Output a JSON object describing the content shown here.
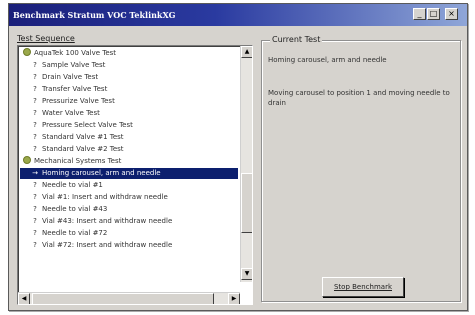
{
  "window": {
    "title": "Benchmark Stratum VOC TeklinkXG",
    "min_glyph": "_",
    "max_glyph": "□",
    "close_glyph": "×"
  },
  "sequence": {
    "label": "Test Sequence",
    "items": [
      {
        "icon": "group",
        "label": "AquaTek 100 Valve Test",
        "selected": false
      },
      {
        "icon": "?",
        "label": "Sample Valve Test",
        "selected": false
      },
      {
        "icon": "?",
        "label": "Drain Valve Test",
        "selected": false
      },
      {
        "icon": "?",
        "label": "Transfer Valve Test",
        "selected": false
      },
      {
        "icon": "?",
        "label": "Pressurize Valve Test",
        "selected": false
      },
      {
        "icon": "?",
        "label": "Water Valve Test",
        "selected": false
      },
      {
        "icon": "?",
        "label": "Pressure Select Valve Test",
        "selected": false
      },
      {
        "icon": "?",
        "label": "Standard Valve #1 Test",
        "selected": false
      },
      {
        "icon": "?",
        "label": "Standard Valve #2 Test",
        "selected": false
      },
      {
        "icon": "group",
        "label": "Mechanical Systems Test",
        "selected": false
      },
      {
        "icon": "→",
        "label": "Homing carousel, arm and needle",
        "selected": true
      },
      {
        "icon": "?",
        "label": "Needle to vial #1",
        "selected": false
      },
      {
        "icon": "?",
        "label": "Vial #1: Insert and withdraw needle",
        "selected": false
      },
      {
        "icon": "?",
        "label": "Needle to vial #43",
        "selected": false
      },
      {
        "icon": "?",
        "label": "Vial #43: Insert and withdraw needle",
        "selected": false
      },
      {
        "icon": "?",
        "label": "Needle to vial #72",
        "selected": false
      },
      {
        "icon": "?",
        "label": "Vial #72: Insert and withdraw needle",
        "selected": false
      }
    ]
  },
  "current_test": {
    "label": "Current Test",
    "name": "Homing carousel, arm and needle",
    "status": "Moving carousel to position 1 and moving needle to drain"
  },
  "stop_button": {
    "label": "Stop Benchmark"
  }
}
